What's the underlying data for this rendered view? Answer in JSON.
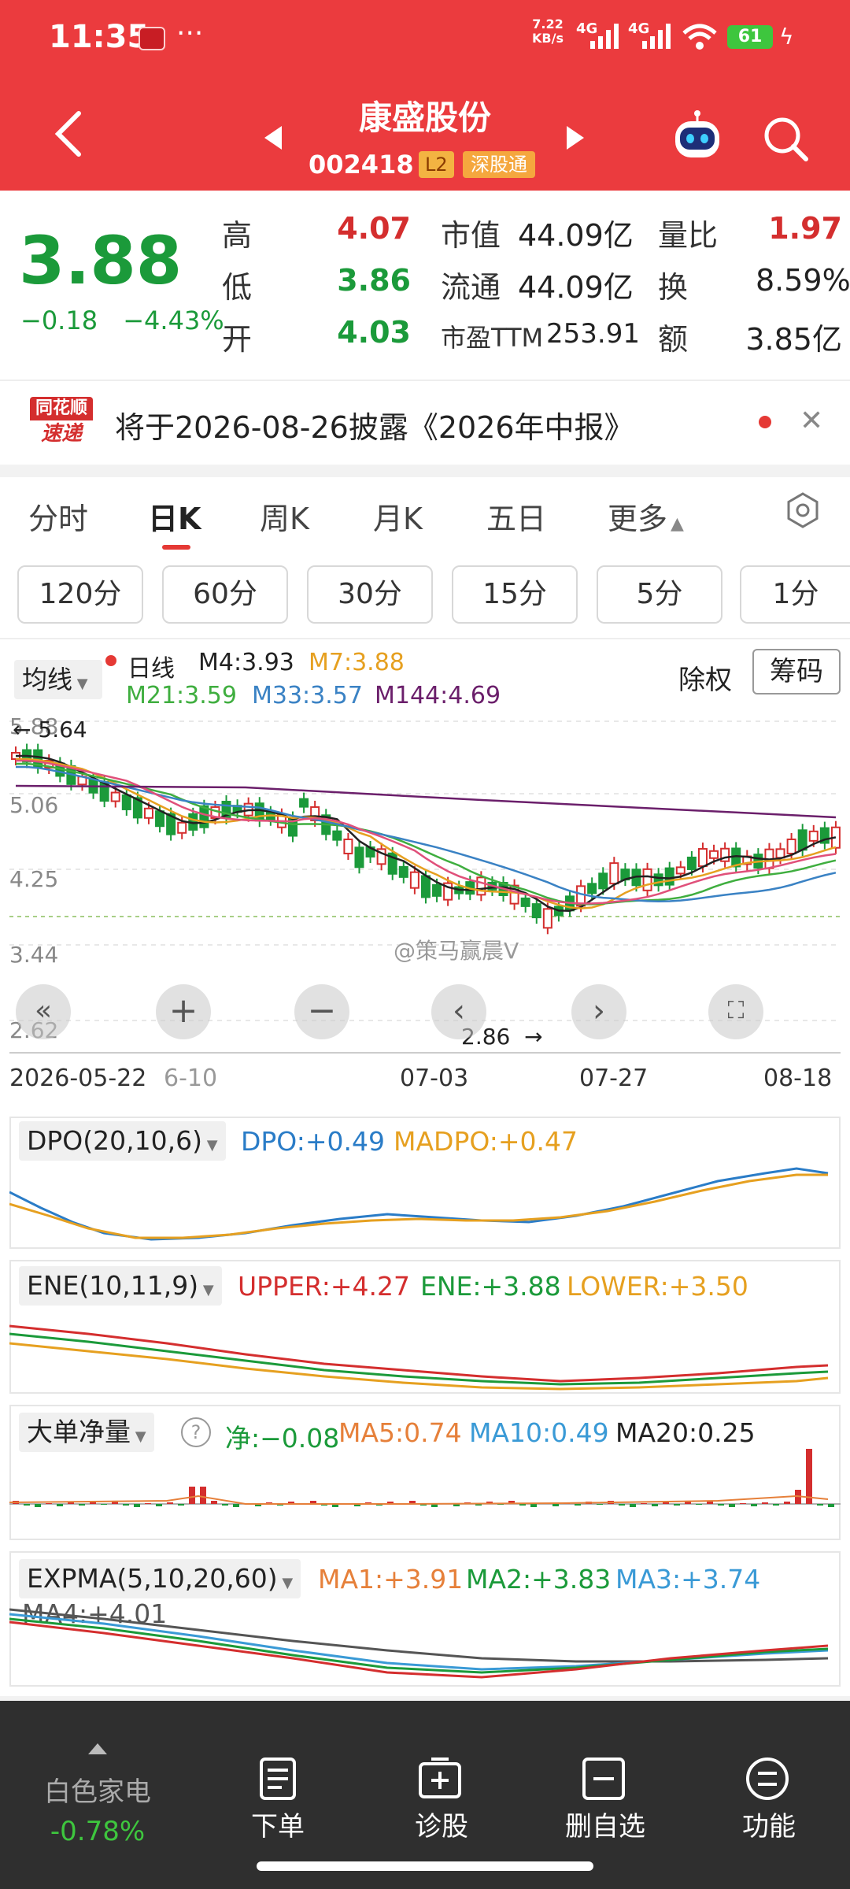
{
  "status_bar": {
    "time": "11:35",
    "more": "···",
    "speed_value": "7.22",
    "speed_unit": "KB/s",
    "net1": "4G",
    "net2": "4G",
    "battery": "61"
  },
  "header": {
    "title": "康盛股份",
    "code": "002418",
    "badge_l2": "L2",
    "badge_market": "深股通"
  },
  "quote": {
    "price": "3.88",
    "change": "−0.18",
    "change_pct": "−4.43%",
    "high_label": "高",
    "high": "4.07",
    "low_label": "低",
    "low": "3.86",
    "open_label": "开",
    "open": "4.03",
    "mktcap_label": "市值",
    "mktcap": "44.09亿",
    "float_label": "流通",
    "float": "44.09亿",
    "pe_label": "市盈TTM",
    "pe": "253.91",
    "volratio_label": "量比",
    "volratio": "1.97",
    "turnover_label": "换",
    "turnover": "8.59%",
    "amount_label": "额",
    "amount": "3.85亿"
  },
  "news": {
    "logo_line1": "同花顺",
    "logo_line2": "速递",
    "text": "将于2026-08-26披露《2026年中报》"
  },
  "tabs": [
    {
      "label": "分时"
    },
    {
      "label": "日K"
    },
    {
      "label": "周K"
    },
    {
      "label": "月K"
    },
    {
      "label": "五日"
    },
    {
      "label": "更多"
    }
  ],
  "periods": [
    "120分",
    "60分",
    "30分",
    "15分",
    "5分",
    "1分"
  ],
  "legend": {
    "ma_selector": "均线",
    "kind": "日线",
    "m4": "M4:3.93",
    "m7": "M7:3.88",
    "m21": "M21:3.59",
    "m33": "M33:3.57",
    "m144": "M144:4.69",
    "fq": "除权",
    "chips": "筹码"
  },
  "main_chart": {
    "price_labels": [
      "5.88",
      "5.06",
      "4.25",
      "3.44",
      "2.62"
    ],
    "high_mark": "5.64",
    "low_mark": "2.86",
    "dates": [
      "2026-05-22",
      "6-10",
      "07-03",
      "07-27",
      "08-18"
    ],
    "watermark": "@策马赢晨V"
  },
  "panels": {
    "dpo": {
      "name": "DPO(20,10,6)",
      "v1": "DPO:+0.49",
      "v2": "MADPO:+0.47"
    },
    "ene": {
      "name": "ENE(10,11,9)",
      "v1": "UPPER:+4.27",
      "v2": "ENE:+3.88",
      "v3": "LOWER:+3.50"
    },
    "ddx": {
      "name": "大单净量",
      "v1": "净:−0.08",
      "v2": "MA5:0.74",
      "v3": "MA10:0.49",
      "v4": "MA20:0.25"
    },
    "expma": {
      "name": "EXPMA(5,10,20,60)",
      "v1": "MA1:+3.91",
      "v2": "MA2:+3.83",
      "v3": "MA3:+3.74",
      "v4": "MA4:+4.01"
    }
  },
  "bottom": {
    "sector_name": "白色家电",
    "sector_chg": "-0.78%",
    "items": [
      "下单",
      "诊股",
      "删自选",
      "功能"
    ]
  },
  "colors": {
    "header_red": "#eb3b3e",
    "up_red": "#d42e2e",
    "down_green": "#1b9a3a",
    "ma_orange": "#e6a020",
    "ma_blue": "#3a82c4",
    "ma_purple": "#6b1f6b"
  }
}
